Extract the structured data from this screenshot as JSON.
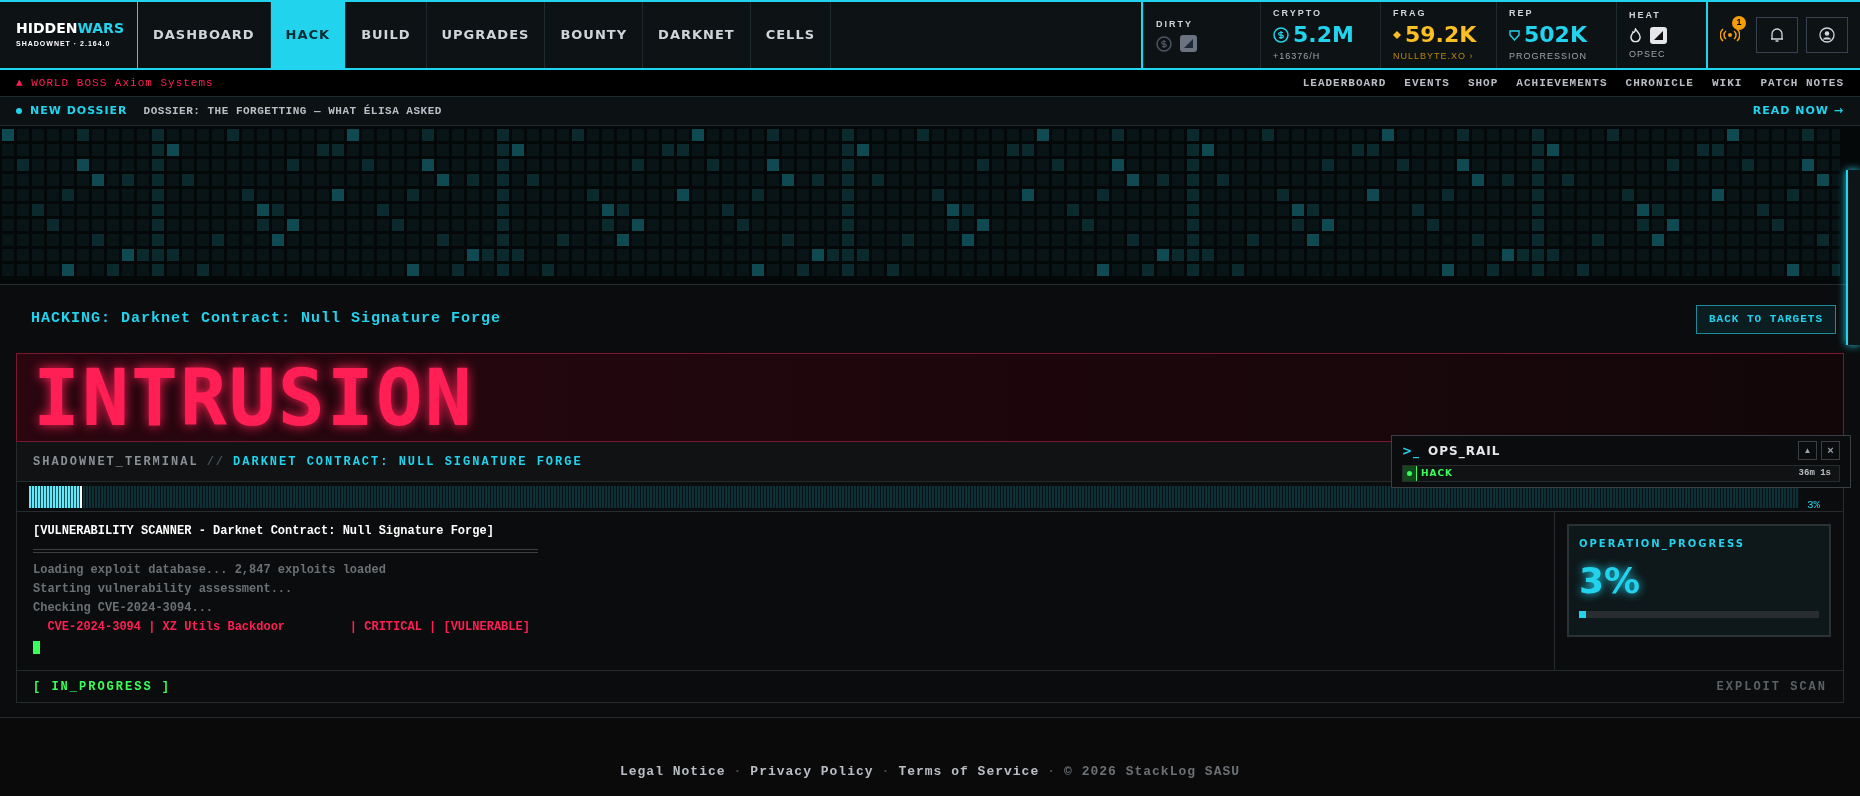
{
  "brand": {
    "title_a": "HIDDEN",
    "title_b": "WARS",
    "subtitle": "SHADOWNET · 2.164.0"
  },
  "nav_tabs": [
    {
      "label": "DASHBOARD",
      "selected": false
    },
    {
      "label": "HACK",
      "selected": true
    },
    {
      "label": "BUILD",
      "selected": false
    },
    {
      "label": "UPGRADES",
      "selected": false
    },
    {
      "label": "BOUNTY",
      "selected": false
    },
    {
      "label": "DARKNET",
      "selected": false
    },
    {
      "label": "CELLS",
      "selected": false
    }
  ],
  "stats": [
    {
      "kind": "icons",
      "label": "DIRTY"
    },
    {
      "kind": "value",
      "label": "CRYPTO",
      "value": "5.2M",
      "sub": "+16376/H",
      "color": "#22d3ee"
    },
    {
      "kind": "value",
      "label": "FRAG",
      "value": "59.2K",
      "sub": "NULLBYTE.XO ›",
      "color": "#fbbf24"
    },
    {
      "kind": "value",
      "label": "REP",
      "value": "502K",
      "sub": "PROGRESSION",
      "color": "#22d3ee"
    },
    {
      "kind": "icons",
      "label": "HEAT",
      "sub": "OPSEC"
    }
  ],
  "signal_badge": "1",
  "alert": {
    "icon": "▲",
    "label": "WORLD BOSS",
    "target": "Axiom Systems"
  },
  "links": [
    "LEADERBOARD",
    "EVENTS",
    "SHOP",
    "ACHIEVEMENTS",
    "CHRONICLE",
    "WIKI",
    "PATCH NOTES"
  ],
  "dossier": {
    "label": "NEW DOSSIER",
    "title": "DOSSIER: THE FORGETTING — WHAT ÉLISA ASKED",
    "action": "READ NOW →"
  },
  "hack": {
    "title": "HACKING: Darknet Contract: Null Signature Forge",
    "back": "BACK TO TARGETS",
    "banner": "INTRUSION",
    "terminal_label": "SHADOWNET_TERMINAL",
    "separator": "//",
    "target": "DARKNET CONTRACT: NULL SIGNATURE FORGE",
    "scan": {
      "level": 0.03,
      "reading": "3%"
    },
    "log_title": "[VULNERABILITY SCANNER - Darknet Contract: Null Signature Forge]",
    "log_lines": [
      {
        "kind": "info",
        "text": "Loading exploit database... 2,847 exploits loaded"
      },
      {
        "kind": "info",
        "text": "Starting vulnerability assessment..."
      },
      {
        "kind": "info",
        "text": "Checking CVE-2024-3094..."
      },
      {
        "kind": "alert",
        "text": "  CVE-2024-3094 | XZ Utils Backdoor         | CRITICAL | [VULNERABLE]"
      }
    ],
    "status": "[ IN_PROGRESS ]",
    "mode": "EXPLOIT SCAN",
    "progress": {
      "label": "OPERATION_PROGRESS",
      "reading": "3%",
      "level": 0.03
    }
  },
  "ops_rail": {
    "prompt": ">_",
    "title": "OPS_RAIL",
    "collapse": "▲",
    "close": "×",
    "ops": [
      {
        "label": "HACK",
        "time": "36m 1s",
        "active": true
      }
    ]
  },
  "footer": {
    "links": [
      "Legal Notice",
      "Privacy Policy",
      "Terms of Service"
    ],
    "separator": "·",
    "copyright": "© 2026 StackLog SASU"
  }
}
